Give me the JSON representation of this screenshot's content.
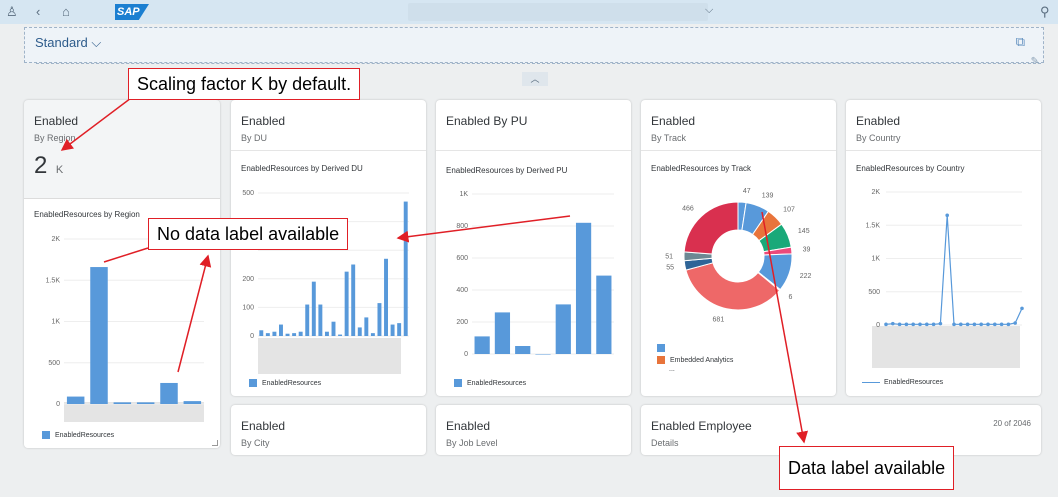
{
  "shell": {
    "logo": "SAP",
    "icons": [
      "user-icon",
      "back-icon",
      "home-icon",
      "search-icon"
    ]
  },
  "filterbar": {
    "variant": "Standard",
    "variant_chevron": "⌵"
  },
  "cards": {
    "region": {
      "title": "Enabled",
      "subtitle": "By Region",
      "kpi_value": "2",
      "kpi_unit": "K",
      "chart_title": "EnabledResources by Region",
      "legend": "EnabledResources"
    },
    "du": {
      "title": "Enabled",
      "subtitle": "By DU",
      "chart_title": "EnabledResources by Derived DU",
      "legend": "EnabledResources"
    },
    "pu": {
      "title": "Enabled By PU",
      "chart_title": "EnabledResources by Derived PU",
      "legend": "EnabledResources"
    },
    "track": {
      "title": "Enabled",
      "subtitle": "By Track",
      "chart_title": "EnabledResources by Track",
      "legend_item": "Embedded Analytics",
      "legend_more": "..."
    },
    "country": {
      "title": "Enabled",
      "subtitle": "By Country",
      "chart_title": "EnabledResources by Country",
      "legend": "EnabledResources"
    },
    "city": {
      "title": "Enabled",
      "subtitle": "By City"
    },
    "joblevel": {
      "title": "Enabled",
      "subtitle": "By Job Level"
    },
    "employee": {
      "title": "Enabled Employee",
      "subtitle": "Details",
      "count": "20 of 2046"
    }
  },
  "annotations": {
    "scaling": "Scaling factor K by default.",
    "no_label": "No data label available",
    "label": "Data label available"
  },
  "colors": {
    "bar": "#5899da",
    "accent": "#e01f26"
  },
  "chart_data": [
    {
      "type": "bar",
      "title": "EnabledResources by Region",
      "values": [
        90,
        1660,
        20,
        20,
        255,
        35
      ],
      "ylim": [
        0,
        2000
      ],
      "yticks": [
        "0",
        "500",
        "1K",
        "1.5K",
        "2K"
      ],
      "series": [
        {
          "name": "EnabledResources"
        }
      ]
    },
    {
      "type": "bar",
      "title": "EnabledResources by Derived DU",
      "values": [
        20,
        10,
        15,
        40,
        8,
        10,
        15,
        110,
        190,
        110,
        15,
        50,
        5,
        225,
        250,
        30,
        65,
        10,
        115,
        270,
        40,
        45,
        470
      ],
      "ylim": [
        0,
        500
      ],
      "yticks": [
        "0",
        "100",
        "200",
        "",
        "",
        "500"
      ],
      "series": [
        {
          "name": "EnabledResources"
        }
      ]
    },
    {
      "type": "bar",
      "title": "EnabledResources by Derived PU",
      "values": [
        110,
        260,
        50,
        0,
        310,
        820,
        490
      ],
      "ylim": [
        0,
        1000
      ],
      "yticks": [
        "0",
        "200",
        "400",
        "600",
        "800",
        "1K"
      ],
      "series": [
        {
          "name": "EnabledResources"
        }
      ]
    },
    {
      "type": "pie",
      "title": "EnabledResources by Track",
      "slices": [
        {
          "value": 47,
          "label": "47",
          "color": "#5899da"
        },
        {
          "value": 139,
          "label": "139",
          "color": "#5899da"
        },
        {
          "value": 107,
          "label": "107",
          "color": "#e8743b"
        },
        {
          "value": 145,
          "label": "145",
          "color": "#19a979"
        },
        {
          "value": 39,
          "label": "39",
          "color": "#ed4a7b"
        },
        {
          "value": 222,
          "label": "222",
          "color": "#5899da"
        },
        {
          "value": 6,
          "label": "6",
          "color": "#945ecf"
        },
        {
          "value": 681,
          "label": "681",
          "color": "#ee6868"
        },
        {
          "value": 55,
          "label": "55",
          "color": "#2f6497"
        },
        {
          "value": 51,
          "label": "51",
          "color": "#6c8893"
        },
        {
          "value": 466,
          "label": "466",
          "color": "#d9304f"
        }
      ]
    },
    {
      "type": "line",
      "title": "EnabledResources by Country",
      "values": [
        10,
        20,
        10,
        10,
        10,
        10,
        10,
        10,
        20,
        1650,
        10,
        10,
        10,
        10,
        10,
        10,
        10,
        10,
        10,
        30,
        250
      ],
      "ylim": [
        0,
        2000
      ],
      "yticks": [
        "0",
        "500",
        "1K",
        "1.5K",
        "2K"
      ],
      "series": [
        {
          "name": "EnabledResources"
        }
      ]
    }
  ]
}
